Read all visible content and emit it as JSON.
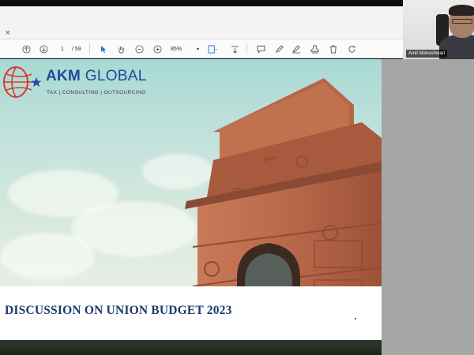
{
  "viewer": {
    "page_current": "1",
    "page_total": "/ 59",
    "zoom": "85%",
    "close_glyph": "×",
    "icons": {
      "up": "arrow-up-circle-icon",
      "down": "arrow-down-circle-icon",
      "select": "cursor-arrow-icon",
      "hand": "hand-icon",
      "zoom_out": "zoom-out-icon",
      "zoom_in": "zoom-in-icon",
      "fit": "fit-page-icon",
      "scroll": "scroll-mode-icon",
      "comment": "comment-icon",
      "pen": "pen-icon",
      "sign": "sign-icon",
      "stamp": "stamp-icon",
      "delete": "trash-icon",
      "rotate": "rotate-icon"
    }
  },
  "video": {
    "participant_name": "Amit Maheshwari"
  },
  "slide": {
    "logo_name_a": "AKM",
    "logo_name_b": " GLOBAL",
    "logo_tagline": "TAX | CONSULTING | OUTSOURCING",
    "title": "DISCUSSION ON UNION BUDGET 2023",
    "monument_inscription": "INDIA"
  },
  "colors": {
    "brand_blue": "#1e4aa0",
    "title_navy": "#1d3a6a",
    "logo_red": "#d83a2c",
    "stone": "#b9684a"
  }
}
